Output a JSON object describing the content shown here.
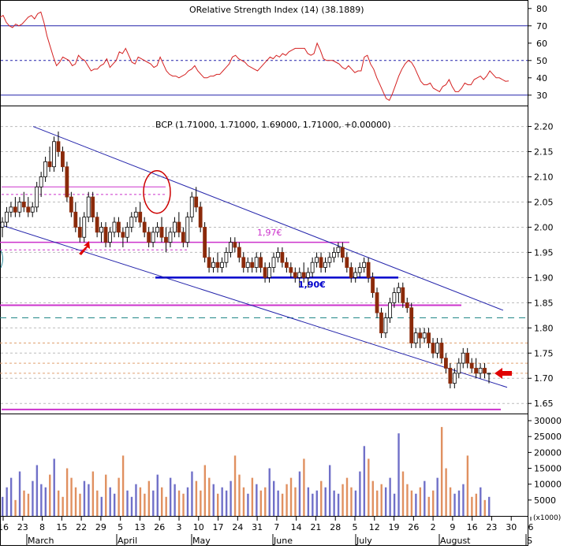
{
  "rsi_panel": {
    "title": "ORelative Strength Index (14) (38.1889)",
    "y_ticks": [
      "80",
      "70",
      "60",
      "50",
      "40",
      "30"
    ],
    "levels": [
      70,
      50,
      30
    ],
    "line_color": "#d42020",
    "values": [
      75,
      76,
      72,
      70,
      69,
      71,
      70,
      71,
      73,
      75,
      76,
      74,
      77,
      78,
      72,
      64,
      58,
      52,
      47,
      49,
      52,
      51,
      50,
      47,
      48,
      53,
      51,
      50,
      47,
      44,
      45,
      45,
      47,
      48,
      51,
      46,
      48,
      50,
      55,
      54,
      57,
      53,
      49,
      48,
      52,
      51,
      50,
      49,
      48,
      46,
      47,
      52,
      48,
      44,
      42,
      41,
      41,
      40,
      41,
      42,
      44,
      45,
      47,
      44,
      42,
      40,
      40,
      41,
      41,
      42,
      42,
      44,
      46,
      48,
      52,
      53,
      51,
      50,
      49,
      47,
      46,
      45,
      44,
      46,
      48,
      50,
      52,
      51,
      53,
      52,
      54,
      53,
      55,
      56,
      57,
      57,
      57,
      57,
      54,
      53,
      54,
      60,
      56,
      51,
      50,
      50,
      50,
      49,
      48,
      46,
      45,
      47,
      45,
      43,
      44,
      44,
      52,
      53,
      48,
      45,
      40,
      36,
      32,
      28,
      27,
      31,
      36,
      41,
      45,
      48,
      50,
      49,
      46,
      42,
      38,
      36,
      36,
      37,
      34,
      33,
      32,
      35,
      36,
      39,
      35,
      32,
      32,
      34,
      37,
      36,
      36,
      39,
      40,
      41,
      39,
      41,
      44,
      42,
      40,
      40,
      39,
      38,
      38.19
    ]
  },
  "price_panel": {
    "title": "BCP (1.71000, 1.71000, 1.69000, 1.71000, +0.00000)",
    "y_ticks": [
      "2.20",
      "2.15",
      "2.10",
      "2.05",
      "2.00",
      "1.95",
      "1.90",
      "1.85",
      "1.80",
      "1.75",
      "1.70",
      "1.65"
    ],
    "annotations": {
      "label_197": "1,97€",
      "label_190": "1,90€",
      "color_197": "#cc33cc",
      "color_190": "#0000cc"
    },
    "colors": {
      "up": "#ffffff",
      "down": "#8b2a0a",
      "outline": "#000000",
      "channel": "#2222aa",
      "support": "#cc33cc",
      "highlight": "#cc0000"
    }
  },
  "volume_panel": {
    "y_ticks": [
      "30000",
      "25000",
      "20000",
      "15000",
      "10000",
      "5000"
    ],
    "unit_label": "(x1000)",
    "colors": {
      "up": "#7070c8",
      "down": "#e09060"
    }
  },
  "x_axis": {
    "day_ticks": [
      "16",
      "23",
      "8",
      "15",
      "22",
      "29",
      "5",
      "13",
      "26",
      "3",
      "10",
      "17",
      "24",
      "31",
      "7",
      "14",
      "21",
      "28",
      "5",
      "12",
      "19",
      "26",
      "2",
      "9",
      "16",
      "23",
      "30",
      "6"
    ],
    "months": [
      "March",
      "April",
      "May",
      "June",
      "July",
      "August",
      "S"
    ]
  },
  "chart_data": {
    "type": "candlestick",
    "title": "BCP (1.71000, 1.71000, 1.69000, 1.71000, +0.00000)",
    "ylim": [
      1.63,
      2.24
    ],
    "last_bar": {
      "open": 1.71,
      "high": 1.71,
      "low": 1.69,
      "close": 1.71,
      "change": 0.0
    },
    "ohlc": [
      [
        2.0,
        2.02,
        1.98,
        2.01
      ],
      [
        2.01,
        2.04,
        2.0,
        2.03
      ],
      [
        2.03,
        2.05,
        2.02,
        2.04
      ],
      [
        2.04,
        2.06,
        2.02,
        2.03
      ],
      [
        2.03,
        2.06,
        2.02,
        2.05
      ],
      [
        2.05,
        2.07,
        2.03,
        2.04
      ],
      [
        2.04,
        2.06,
        2.02,
        2.03
      ],
      [
        2.03,
        2.05,
        2.02,
        2.04
      ],
      [
        2.04,
        2.09,
        2.03,
        2.08
      ],
      [
        2.08,
        2.11,
        2.06,
        2.1
      ],
      [
        2.1,
        2.14,
        2.09,
        2.13
      ],
      [
        2.13,
        2.16,
        2.11,
        2.12
      ],
      [
        2.12,
        2.18,
        2.11,
        2.17
      ],
      [
        2.17,
        2.19,
        2.14,
        2.15
      ],
      [
        2.15,
        2.16,
        2.11,
        2.12
      ],
      [
        2.12,
        2.13,
        2.05,
        2.06
      ],
      [
        2.06,
        2.07,
        2.02,
        2.03
      ],
      [
        2.03,
        2.05,
        1.99,
        2.0
      ],
      [
        2.0,
        2.02,
        1.97,
        1.98
      ],
      [
        1.98,
        2.03,
        1.97,
        2.02
      ],
      [
        2.02,
        2.07,
        2.01,
        2.06
      ],
      [
        2.06,
        2.07,
        2.01,
        2.02
      ],
      [
        2.02,
        2.03,
        1.98,
        1.99
      ],
      [
        1.99,
        2.01,
        1.97,
        2.0
      ],
      [
        2.0,
        2.01,
        1.96,
        1.97
      ],
      [
        1.97,
        2.0,
        1.96,
        1.99
      ],
      [
        1.99,
        2.02,
        1.98,
        2.01
      ],
      [
        2.01,
        2.02,
        1.98,
        1.99
      ],
      [
        1.99,
        2.0,
        1.96,
        1.98
      ],
      [
        1.98,
        2.01,
        1.97,
        2.0
      ],
      [
        2.0,
        2.03,
        1.99,
        2.02
      ],
      [
        2.02,
        2.04,
        2.01,
        2.03
      ],
      [
        2.03,
        2.05,
        2.0,
        2.01
      ],
      [
        2.01,
        2.02,
        1.98,
        1.99
      ],
      [
        1.99,
        2.0,
        1.96,
        1.97
      ],
      [
        1.97,
        2.0,
        1.96,
        1.99
      ],
      [
        1.99,
        2.01,
        1.98,
        2.0
      ],
      [
        2.0,
        2.02,
        1.97,
        1.98
      ],
      [
        1.98,
        2.0,
        1.95,
        1.97
      ],
      [
        1.97,
        2.0,
        1.96,
        1.99
      ],
      [
        1.99,
        2.02,
        1.98,
        2.01
      ],
      [
        2.01,
        2.03,
        1.98,
        1.99
      ],
      [
        1.99,
        2.0,
        1.96,
        1.97
      ],
      [
        1.97,
        2.03,
        1.96,
        2.02
      ],
      [
        2.02,
        2.07,
        2.01,
        2.06
      ],
      [
        2.06,
        2.08,
        2.03,
        2.04
      ],
      [
        2.04,
        2.05,
        1.99,
        2.0
      ],
      [
        2.0,
        2.01,
        1.93,
        1.94
      ],
      [
        1.94,
        1.96,
        1.91,
        1.92
      ],
      [
        1.92,
        1.94,
        1.91,
        1.93
      ],
      [
        1.93,
        1.95,
        1.91,
        1.92
      ],
      [
        1.92,
        1.94,
        1.91,
        1.93
      ],
      [
        1.93,
        1.96,
        1.92,
        1.95
      ],
      [
        1.95,
        1.98,
        1.94,
        1.97
      ],
      [
        1.97,
        1.98,
        1.95,
        1.96
      ],
      [
        1.96,
        1.97,
        1.93,
        1.94
      ],
      [
        1.94,
        1.95,
        1.91,
        1.92
      ],
      [
        1.92,
        1.94,
        1.91,
        1.93
      ],
      [
        1.93,
        1.94,
        1.91,
        1.92
      ],
      [
        1.92,
        1.95,
        1.91,
        1.94
      ],
      [
        1.94,
        1.95,
        1.91,
        1.92
      ],
      [
        1.92,
        1.93,
        1.89,
        1.9
      ],
      [
        1.9,
        1.93,
        1.89,
        1.92
      ],
      [
        1.92,
        1.95,
        1.91,
        1.94
      ],
      [
        1.94,
        1.96,
        1.93,
        1.95
      ],
      [
        1.95,
        1.96,
        1.92,
        1.93
      ],
      [
        1.93,
        1.94,
        1.91,
        1.92
      ],
      [
        1.92,
        1.93,
        1.9,
        1.91
      ],
      [
        1.91,
        1.92,
        1.89,
        1.9
      ],
      [
        1.9,
        1.92,
        1.88,
        1.91
      ],
      [
        1.91,
        1.93,
        1.89,
        1.9
      ],
      [
        1.9,
        1.92,
        1.88,
        1.91
      ],
      [
        1.91,
        1.94,
        1.9,
        1.93
      ],
      [
        1.93,
        1.95,
        1.92,
        1.94
      ],
      [
        1.94,
        1.95,
        1.91,
        1.92
      ],
      [
        1.92,
        1.94,
        1.91,
        1.93
      ],
      [
        1.93,
        1.95,
        1.92,
        1.94
      ],
      [
        1.94,
        1.96,
        1.93,
        1.95
      ],
      [
        1.95,
        1.97,
        1.94,
        1.96
      ],
      [
        1.96,
        1.97,
        1.93,
        1.94
      ],
      [
        1.94,
        1.95,
        1.91,
        1.92
      ],
      [
        1.92,
        1.93,
        1.89,
        1.9
      ],
      [
        1.9,
        1.92,
        1.89,
        1.91
      ],
      [
        1.91,
        1.93,
        1.9,
        1.92
      ],
      [
        1.92,
        1.94,
        1.91,
        1.93
      ],
      [
        1.93,
        1.94,
        1.89,
        1.9
      ],
      [
        1.9,
        1.91,
        1.86,
        1.87
      ],
      [
        1.87,
        1.88,
        1.82,
        1.83
      ],
      [
        1.83,
        1.84,
        1.78,
        1.79
      ],
      [
        1.79,
        1.83,
        1.78,
        1.82
      ],
      [
        1.82,
        1.86,
        1.81,
        1.85
      ],
      [
        1.85,
        1.88,
        1.84,
        1.87
      ],
      [
        1.87,
        1.89,
        1.85,
        1.88
      ],
      [
        1.88,
        1.89,
        1.84,
        1.85
      ],
      [
        1.85,
        1.86,
        1.83,
        1.84
      ],
      [
        1.84,
        1.85,
        1.76,
        1.77
      ],
      [
        1.77,
        1.8,
        1.76,
        1.79
      ],
      [
        1.79,
        1.8,
        1.76,
        1.78
      ],
      [
        1.78,
        1.8,
        1.77,
        1.79
      ],
      [
        1.79,
        1.8,
        1.76,
        1.77
      ],
      [
        1.77,
        1.78,
        1.74,
        1.75
      ],
      [
        1.75,
        1.78,
        1.74,
        1.77
      ],
      [
        1.77,
        1.78,
        1.73,
        1.74
      ],
      [
        1.74,
        1.75,
        1.71,
        1.72
      ],
      [
        1.72,
        1.73,
        1.68,
        1.69
      ],
      [
        1.69,
        1.72,
        1.68,
        1.71
      ],
      [
        1.71,
        1.74,
        1.7,
        1.73
      ],
      [
        1.73,
        1.76,
        1.72,
        1.75
      ],
      [
        1.75,
        1.76,
        1.72,
        1.73
      ],
      [
        1.73,
        1.74,
        1.71,
        1.72
      ],
      [
        1.72,
        1.74,
        1.7,
        1.71
      ],
      [
        1.71,
        1.73,
        1.7,
        1.72
      ],
      [
        1.72,
        1.73,
        1.7,
        1.71
      ],
      [
        1.71,
        1.71,
        1.69,
        1.71
      ]
    ],
    "volume": [
      6000,
      9000,
      12000,
      5000,
      14000,
      8000,
      7000,
      11000,
      16000,
      10000,
      9000,
      13000,
      18000,
      8000,
      6000,
      15000,
      12000,
      9000,
      7000,
      11000,
      10000,
      14000,
      8000,
      6000,
      13000,
      9000,
      7000,
      12000,
      19000,
      8000,
      6000,
      10000,
      9000,
      7000,
      11000,
      8000,
      13000,
      9000,
      6000,
      12000,
      10000,
      8000,
      7000,
      9000,
      14000,
      11000,
      8000,
      16000,
      12000,
      10000,
      7000,
      9000,
      8000,
      11000,
      19000,
      13000,
      9000,
      7000,
      12000,
      10000,
      8000,
      9000,
      15000,
      11000,
      8000,
      7000,
      10000,
      12000,
      9000,
      14000,
      18000,
      9000,
      7000,
      8000,
      11000,
      9000,
      16000,
      8000,
      7000,
      10000,
      12000,
      9000,
      8000,
      14000,
      22000,
      18000,
      11000,
      8000,
      10000,
      9000,
      12000,
      7000,
      26000,
      14000,
      10000,
      8000,
      7000,
      9000,
      11000,
      6000,
      8000,
      12000,
      28000,
      15000,
      9000,
      7000,
      8000,
      10000,
      19000,
      6000,
      7000,
      9000,
      5000,
      6000
    ]
  }
}
